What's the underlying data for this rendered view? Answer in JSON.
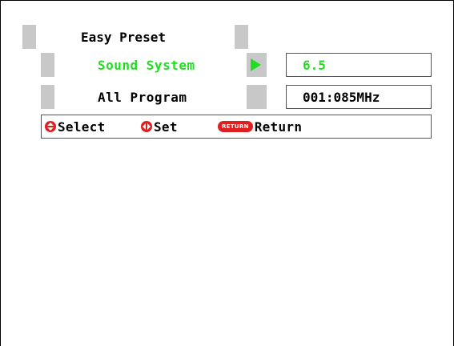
{
  "menu": {
    "title": "Easy Preset",
    "items": [
      {
        "label": "Sound System",
        "value": "6.5",
        "selected": true
      },
      {
        "label": "All Program",
        "value": "001:085MHz",
        "selected": false
      }
    ]
  },
  "help": {
    "select_label": "Select",
    "set_label": "Set",
    "return_badge": "RETURN",
    "return_label": "Return"
  },
  "icons": {
    "select": "up-down-icon",
    "set": "left-right-icon",
    "selection_arrow": "play-arrow-icon"
  },
  "colors": {
    "selected_text": "#22dd22",
    "normal_text": "#000000",
    "accent_red": "#e02020",
    "tab_gray": "#c8c8c8"
  }
}
